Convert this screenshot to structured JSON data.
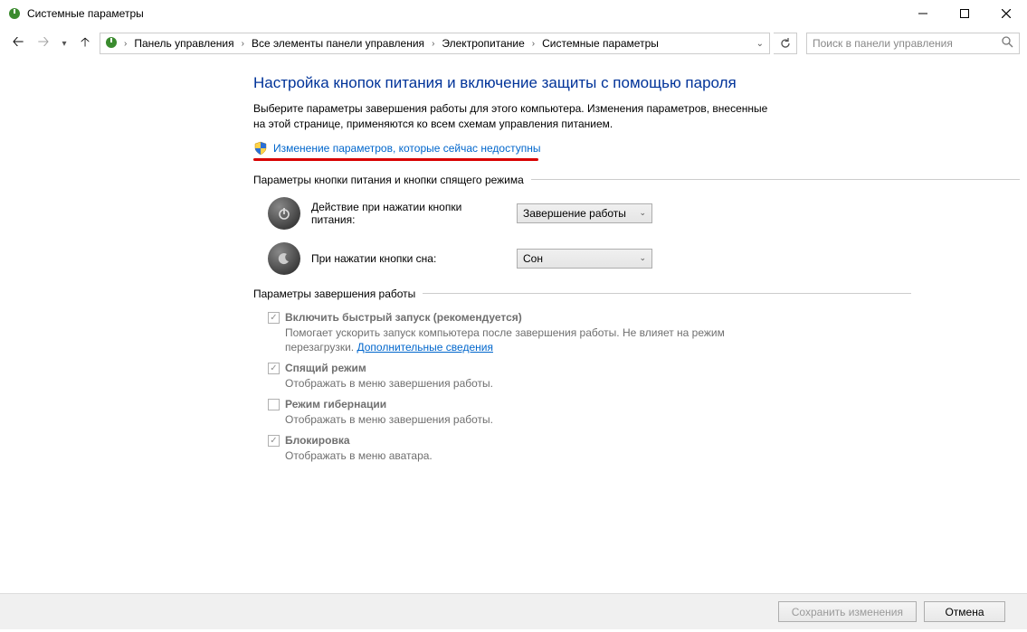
{
  "window": {
    "title": "Системные параметры"
  },
  "breadcrumb": {
    "items": [
      "Панель управления",
      "Все элементы панели управления",
      "Электропитание",
      "Системные параметры"
    ]
  },
  "search": {
    "placeholder": "Поиск в панели управления"
  },
  "main": {
    "heading": "Настройка кнопок питания и включение защиты с помощью пароля",
    "description": "Выберите параметры завершения работы для этого компьютера. Изменения параметров, внесенные на этой странице, применяются ко всем схемам управления питанием.",
    "uac_link": "Изменение параметров, которые сейчас недоступны"
  },
  "buttons_section": {
    "title": "Параметры кнопки питания и кнопки спящего режима",
    "power_button": {
      "label": "Действие при нажатии кнопки питания:",
      "value": "Завершение работы"
    },
    "sleep_button": {
      "label": "При нажатии кнопки сна:",
      "value": "Сон"
    }
  },
  "shutdown_section": {
    "title": "Параметры завершения работы",
    "items": [
      {
        "checked": true,
        "label": "Включить быстрый запуск (рекомендуется)",
        "desc_prefix": "Помогает ускорить запуск компьютера после завершения работы. Не влияет на режим перезагрузки. ",
        "link": "Дополнительные сведения"
      },
      {
        "checked": true,
        "label": "Спящий режим",
        "desc": "Отображать в меню завершения работы."
      },
      {
        "checked": false,
        "label": "Режим гибернации",
        "desc": "Отображать в меню завершения работы."
      },
      {
        "checked": true,
        "label": "Блокировка",
        "desc": "Отображать в меню аватара."
      }
    ]
  },
  "footer": {
    "save": "Сохранить изменения",
    "cancel": "Отмена"
  }
}
